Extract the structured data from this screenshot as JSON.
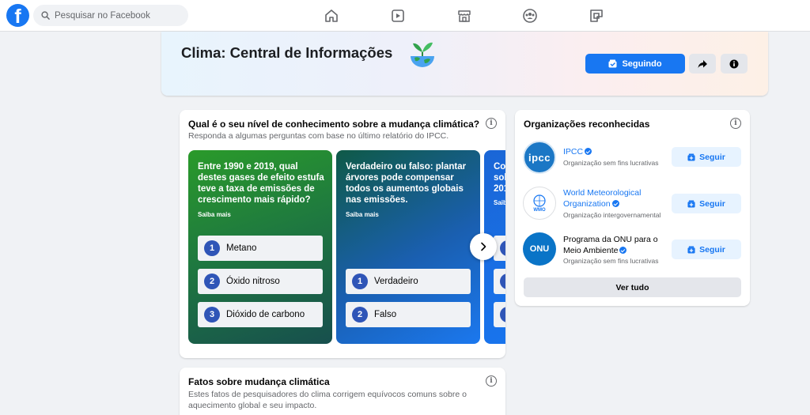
{
  "topbar": {
    "logo": "f",
    "search_placeholder": "Pesquisar no Facebook",
    "nav_icons": [
      "home-icon",
      "watch-icon",
      "marketplace-icon",
      "groups-icon",
      "gaming-icon"
    ]
  },
  "header": {
    "title": "Clima: Central de Informações",
    "following_label": "Seguindo",
    "share_icon": "share-icon",
    "info_icon": "info-icon"
  },
  "quiz": {
    "title": "Qual é o seu nível de conhecimento sobre a mudança climática?",
    "subtitle": "Responda a algumas perguntas com base no último relatório do IPCC.",
    "cards": [
      {
        "question": "Entre 1990 e 2019, qual destes gases de efeito estufa teve a taxa de emissões de crescimento mais rápido?",
        "more": "Saiba mais",
        "options": [
          {
            "num": "1",
            "label": "Metano"
          },
          {
            "num": "2",
            "label": "Óxido nitroso"
          },
          {
            "num": "3",
            "label": "Dióxido de carbono"
          }
        ]
      },
      {
        "question": "Verdadeiro ou falso: plantar árvores pode compensar todos os aumentos globais nas emissões.",
        "more": "Saiba mais",
        "options": [
          {
            "num": "1",
            "label": "Verdadeiro"
          },
          {
            "num": "2",
            "label": "Falso"
          }
        ]
      },
      {
        "question_lines": [
          "Co",
          "sol",
          "201"
        ],
        "more": "Saiba"
      }
    ]
  },
  "orgs": {
    "title": "Organizações reconhecidas",
    "items": [
      {
        "name": "IPCC",
        "logo_text": "ipcc",
        "type": "Organização sem fins lucrativas",
        "follow": "Seguir"
      },
      {
        "name": "World Meteorological Organization",
        "logo_text": "WMO",
        "type": "Organização intergovernamental",
        "follow": "Seguir"
      },
      {
        "name": "Programa da ONU para o Meio Ambiente",
        "logo_text": "ONU",
        "type": "Organização sem fins lucrativas",
        "follow": "Seguir"
      }
    ],
    "see_all": "Ver tudo"
  },
  "facts": {
    "title": "Fatos sobre mudança climática",
    "subtitle": "Estes fatos de pesquisadores do clima corrigem equívocos comuns sobre o aquecimento global e seu impacto."
  },
  "colors": {
    "brand_blue": "#1877f2",
    "card1_gradient": [
      "#1f8a2c",
      "#1e6b45",
      "#1a5a52"
    ],
    "card2_gradient": [
      "#0f5d4e",
      "#1a5fb4",
      "#1877f2"
    ]
  }
}
